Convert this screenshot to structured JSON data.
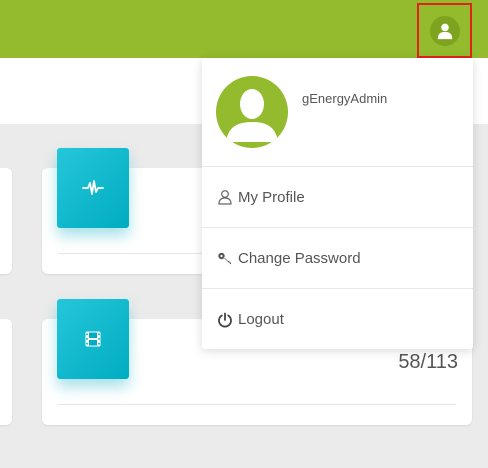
{
  "user": {
    "name": "gEnergyAdmin",
    "avatar_icon": "user-icon"
  },
  "menu": {
    "items": [
      {
        "label": "My Profile",
        "icon": "user-icon"
      },
      {
        "label": "Change Password",
        "icon": "key-icon"
      },
      {
        "label": "Logout",
        "icon": "power-icon"
      }
    ]
  },
  "cards": [
    {
      "icon": "pulse-icon",
      "value": ""
    },
    {
      "icon": "film-icon",
      "value": "58/113"
    }
  ],
  "colors": {
    "topbar": "#93bb2d",
    "tile": "#00acc1",
    "highlight": "#e0241b"
  }
}
